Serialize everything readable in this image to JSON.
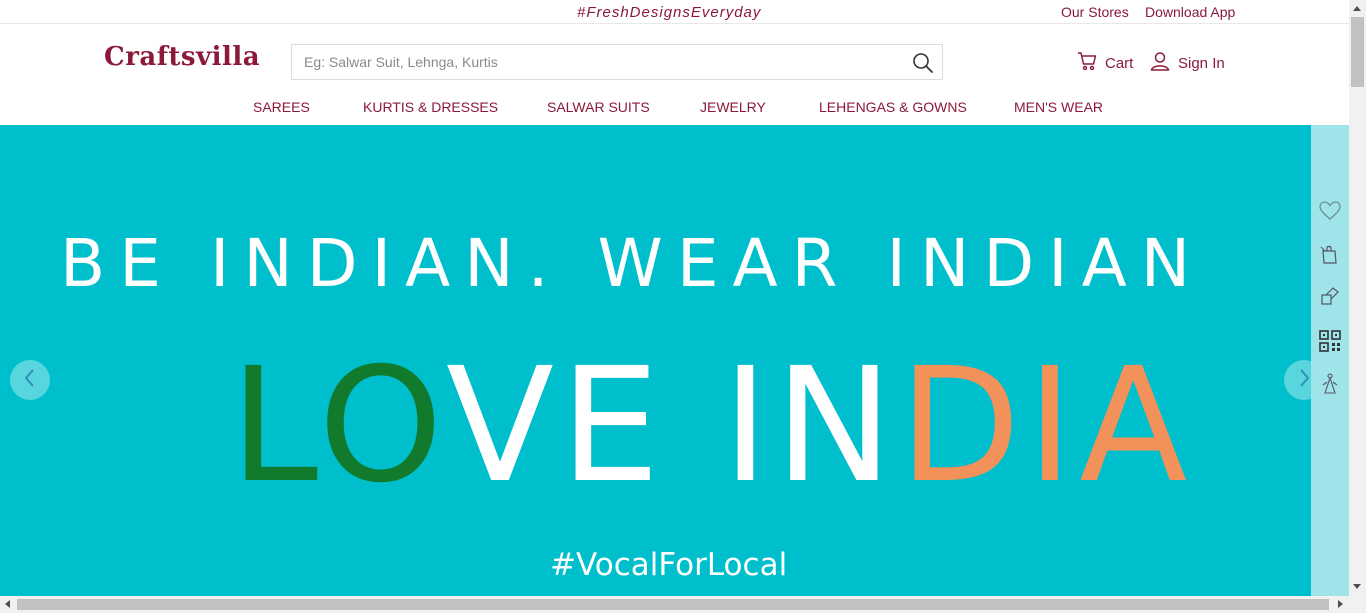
{
  "topbar": {
    "tagline": "#FreshDesignsEveryday",
    "links": [
      "Our Stores",
      "Download App"
    ]
  },
  "header": {
    "logo": "Craftsvilla",
    "search_placeholder": "Eg: Salwar Suit, Lehnga, Kurtis",
    "search_value": "",
    "cart_label": "Cart",
    "signin_label": "Sign In"
  },
  "nav": {
    "items": [
      "SAREES",
      "KURTIS & DRESSES",
      "SALWAR SUITS",
      "JEWELRY",
      "LEHENGAS & GOWNS",
      "MEN'S WEAR"
    ]
  },
  "hero": {
    "line1": "BE INDIAN. WEAR  INDIAN",
    "love_part1": "LO",
    "love_part2": "VE IN",
    "love_part3": "DIA",
    "tagline": "#VocalForLocal",
    "background": "#00bfcc",
    "colors": {
      "green": "#117a2c",
      "white": "#ffffff",
      "orange": "#f2925a"
    }
  },
  "side_rail": {
    "icons": [
      "heart-icon",
      "shopping-bag-icon",
      "gift-icon",
      "qr-code-icon",
      "saree-icon"
    ]
  },
  "theme": {
    "brand": "#8b1a3a"
  }
}
